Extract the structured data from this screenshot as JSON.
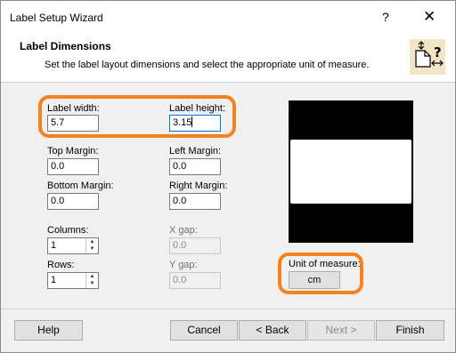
{
  "window": {
    "title": "Label Setup Wizard",
    "help_glyph": "?",
    "close_glyph": "✕"
  },
  "header": {
    "title": "Label Dimensions",
    "subtitle": "Set the label layout dimensions and select the appropriate unit of measure.",
    "icon": "label-dimensions-icon"
  },
  "fields": {
    "label_width": {
      "label": "Label width:",
      "value": "5.7"
    },
    "label_height": {
      "label": "Label height:",
      "value": "3.15"
    },
    "top_margin": {
      "label": "Top Margin:",
      "value": "0.0"
    },
    "left_margin": {
      "label": "Left Margin:",
      "value": "0.0"
    },
    "bottom_margin": {
      "label": "Bottom Margin:",
      "value": "0.0"
    },
    "right_margin": {
      "label": "Right Margin:",
      "value": "0.0"
    },
    "columns": {
      "label": "Columns:",
      "value": "1"
    },
    "x_gap": {
      "label": "X gap:",
      "value": "0.0"
    },
    "rows": {
      "label": "Rows:",
      "value": "1"
    },
    "y_gap": {
      "label": "Y gap:",
      "value": "0.0"
    }
  },
  "unit": {
    "label": "Unit of measure:",
    "value": "cm"
  },
  "buttons": {
    "help": "Help",
    "cancel": "Cancel",
    "back": "< Back",
    "next": "Next >",
    "finish": "Finish"
  },
  "colors": {
    "highlight": "#f5821f",
    "focus_border": "#0078d7"
  }
}
